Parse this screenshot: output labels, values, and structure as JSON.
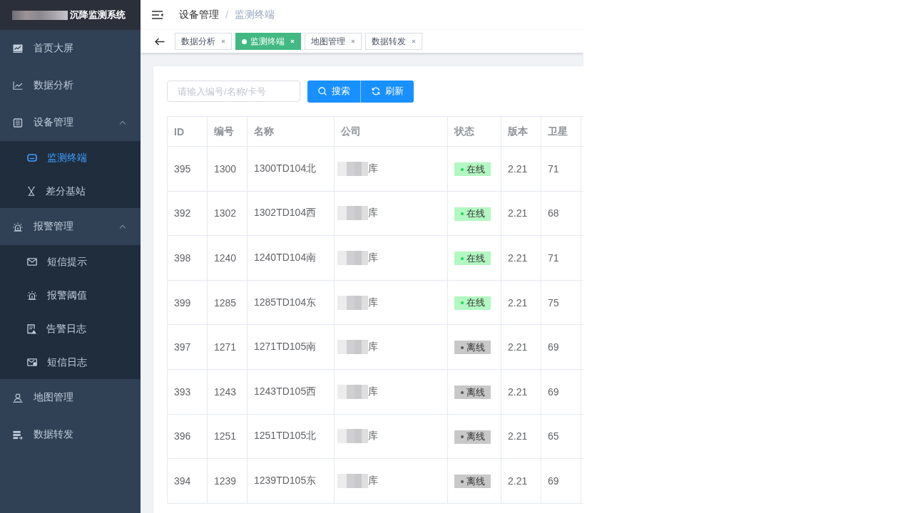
{
  "app": {
    "title": "沉降监测系统"
  },
  "sidebar": {
    "items": [
      {
        "label": "首页大屏",
        "selected": false
      },
      {
        "label": "数据分析",
        "selected": false
      },
      {
        "label": "设备管理",
        "selected": false,
        "expanded": true,
        "children": [
          {
            "label": "监测终端",
            "selected": true
          },
          {
            "label": "差分基站",
            "selected": false
          }
        ]
      },
      {
        "label": "报警管理",
        "selected": false,
        "expanded": true,
        "children": [
          {
            "label": "短信提示",
            "selected": false
          },
          {
            "label": "报警阈值",
            "selected": false
          },
          {
            "label": "告警日志",
            "selected": false
          },
          {
            "label": "短信日志",
            "selected": false
          }
        ]
      },
      {
        "label": "地图管理",
        "selected": false
      },
      {
        "label": "数据转发",
        "selected": false
      }
    ]
  },
  "header": {
    "breadcrumb": {
      "separator": "/",
      "items": [
        {
          "label": "设备管理"
        },
        {
          "label": "监测终端"
        }
      ]
    }
  },
  "tabs": [
    {
      "label": "数据分析",
      "selected": false
    },
    {
      "label": "监测终端",
      "selected": true
    },
    {
      "label": "地图管理",
      "selected": false
    },
    {
      "label": "数据转发",
      "selected": false
    }
  ],
  "toolbar": {
    "search": {
      "placeholder": "请输入编号/名称/卡号"
    },
    "buttons": [
      {
        "label": "搜索",
        "kind": "search"
      },
      {
        "label": "刷新",
        "kind": "refresh"
      }
    ]
  },
  "table": {
    "columns": [
      "ID",
      "编号",
      "名称",
      "公司",
      "状态",
      "版本",
      "卫星"
    ],
    "rows": [
      {
        "id": "395",
        "code": "1300",
        "name": "1300TD104北",
        "company": "库",
        "status": {
          "label": "在线",
          "kind": "online"
        },
        "version": "2.21",
        "satellites": "71"
      },
      {
        "id": "392",
        "code": "1302",
        "name": "1302TD104西",
        "company": "库",
        "status": {
          "label": "在线",
          "kind": "online"
        },
        "version": "2.21",
        "satellites": "68"
      },
      {
        "id": "398",
        "code": "1240",
        "name": "1240TD104南",
        "company": "库",
        "status": {
          "label": "在线",
          "kind": "online"
        },
        "version": "2.21",
        "satellites": "71"
      },
      {
        "id": "399",
        "code": "1285",
        "name": "1285TD104东",
        "company": "库",
        "status": {
          "label": "在线",
          "kind": "online"
        },
        "version": "2.21",
        "satellites": "75"
      },
      {
        "id": "397",
        "code": "1271",
        "name": "1271TD105南",
        "company": "库",
        "status": {
          "label": "离线",
          "kind": "offline"
        },
        "version": "2.21",
        "satellites": "69"
      },
      {
        "id": "393",
        "code": "1243",
        "name": "1243TD105西",
        "company": "库",
        "status": {
          "label": "离线",
          "kind": "offline"
        },
        "version": "2.21",
        "satellites": "69"
      },
      {
        "id": "396",
        "code": "1251",
        "name": "1251TD105北",
        "company": "库",
        "status": {
          "label": "离线",
          "kind": "offline"
        },
        "version": "2.21",
        "satellites": "65"
      },
      {
        "id": "394",
        "code": "1239",
        "name": "1239TD105东",
        "company": "库",
        "status": {
          "label": "离线",
          "kind": "offline"
        },
        "version": "2.21",
        "satellites": "69"
      }
    ]
  }
}
